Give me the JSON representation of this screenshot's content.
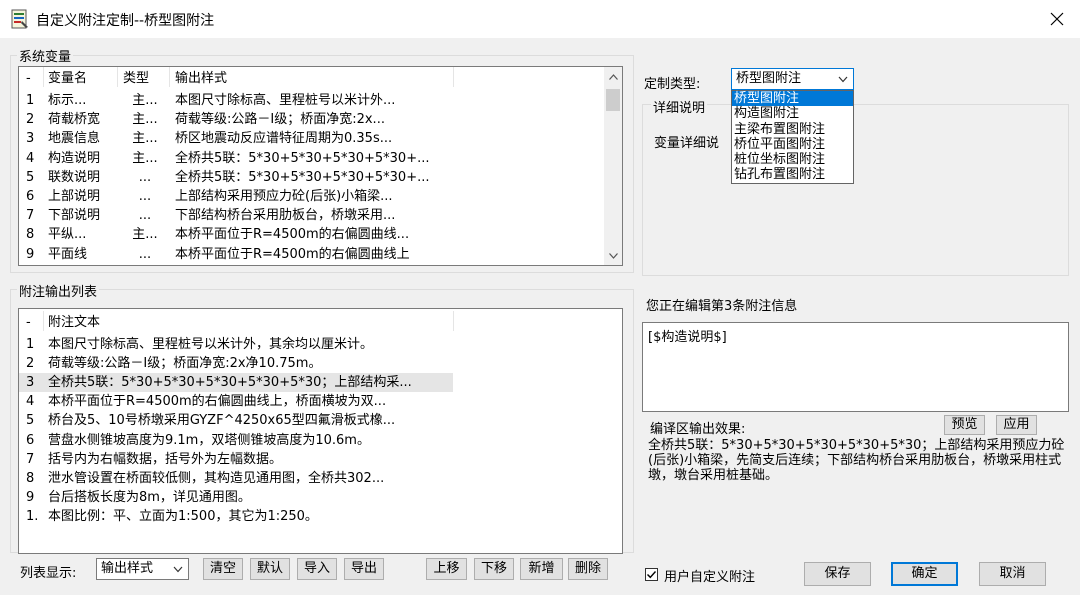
{
  "window": {
    "title": "自定义附注定制--桥型图附注"
  },
  "system_vars": {
    "group_label": "系统变量",
    "columns": [
      "-",
      "变量名",
      "类型",
      "输出样式"
    ],
    "rows": [
      {
        "idx": "1",
        "name": "标示...",
        "type": "主...",
        "style": "本图尺寸除标高、里程桩号以米计外..."
      },
      {
        "idx": "2",
        "name": "荷载桥宽",
        "type": "主...",
        "style": "荷载等级:公路－Ⅰ级；桥面净宽:2x..."
      },
      {
        "idx": "3",
        "name": "地震信息",
        "type": "主...",
        "style": "桥区地震动反应谱特征周期为0.35s..."
      },
      {
        "idx": "4",
        "name": "构造说明",
        "type": "主...",
        "style": "全桥共5联：5*30+5*30+5*30+5*30+..."
      },
      {
        "idx": "5",
        "name": "联数说明",
        "type": "...",
        "style": "全桥共5联：5*30+5*30+5*30+5*30+..."
      },
      {
        "idx": "6",
        "name": "上部说明",
        "type": "...",
        "style": "上部结构采用预应力砼(后张)小箱梁..."
      },
      {
        "idx": "7",
        "name": "下部说明",
        "type": "...",
        "style": "下部结构桥台采用肋板台，桥墩采用..."
      },
      {
        "idx": "8",
        "name": "平纵...",
        "type": "主...",
        "style": "本桥平面位于R=4500m的右偏圆曲线..."
      },
      {
        "idx": "9",
        "name": "平面线",
        "type": "...",
        "style": "本桥平面位于R=4500m的右偏圆曲线上"
      }
    ]
  },
  "notes": {
    "group_label": "附注输出列表",
    "columns": [
      "-",
      "附注文本"
    ],
    "rows": [
      {
        "idx": "1",
        "text": "本图尺寸除标高、里程桩号以米计外，其余均以厘米计。"
      },
      {
        "idx": "2",
        "text": "荷载等级:公路－Ⅰ级；桥面净宽:2x净10.75m。"
      },
      {
        "idx": "3",
        "text": "全桥共5联：5*30+5*30+5*30+5*30+5*30；上部结构采..."
      },
      {
        "idx": "4",
        "text": "本桥平面位于R=4500m的右偏圆曲线上，桥面横坡为双..."
      },
      {
        "idx": "5",
        "text": "桥台及5、10号桥墩采用GYZF^4250x65型四氟滑板式橡..."
      },
      {
        "idx": "6",
        "text": "营盘水侧锥坡高度为9.1m，双塔侧锥坡高度为10.6m。"
      },
      {
        "idx": "7",
        "text": "括号内为右幅数据，括号外为左幅数据。"
      },
      {
        "idx": "8",
        "text": "泄水管设置在桥面较低侧，其构造见通用图，全桥共302..."
      },
      {
        "idx": "9",
        "text": "台后搭板长度为8m，详见通用图。"
      },
      {
        "idx": "1.",
        "text": "本图比例：平、立面为1:500，其它为1:250。"
      }
    ]
  },
  "bottom_bar": {
    "list_display_label": "列表显示:",
    "list_display_value": "输出样式",
    "buttons": [
      "清空",
      "默认",
      "导入",
      "导出",
      "上移",
      "下移",
      "新增",
      "删除"
    ]
  },
  "right": {
    "custom_type_label": "定制类型:",
    "custom_type_value": "桥型图附注",
    "dropdown_options": [
      "桥型图附注",
      "构造图附注",
      "主梁布置图附注",
      "桥位平面图附注",
      "桩位坐标图附注",
      "钻孔布置图附注"
    ],
    "detail_group_label": "详细说明",
    "var_detail_label": "变量详细说",
    "editing_label": "您正在编辑第3条附注信息",
    "editor_text": "[$构造说明$]",
    "compile_label": "编译区输出效果:",
    "preview_button": "预览",
    "apply_button": "应用",
    "compile_output": "全桥共5联：5*30+5*30+5*30+5*30+5*30；上部结构采用预应力砼(后张)小箱梁，先简支后连续；下部结构桥台采用肋板台，桥墩采用柱式墩，墩台采用桩基础。",
    "user_custom_label": "用户自定义附注",
    "user_custom_checked": true,
    "save_button": "保存",
    "ok_button": "确定",
    "cancel_button": "取消"
  }
}
